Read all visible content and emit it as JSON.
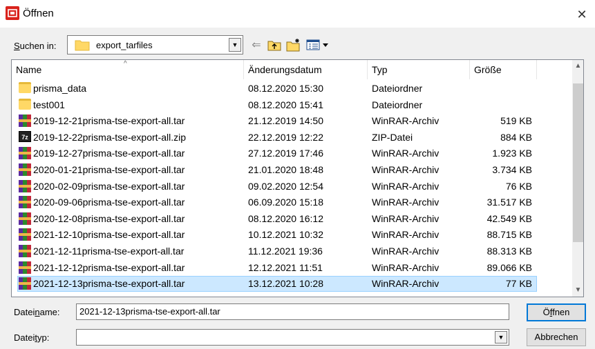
{
  "window": {
    "title": "Öffnen"
  },
  "toolbar": {
    "look_in_label_pre": "",
    "look_in_label_u": "S",
    "look_in_label_post": "uchen in:",
    "look_in_value": "export_tarfiles"
  },
  "columns": {
    "name": "Name",
    "date": "Änderungsdatum",
    "type": "Typ",
    "size": "Größe"
  },
  "files": [
    {
      "icon": "folder-icon",
      "name": "prisma_data",
      "date": "08.12.2020 15:30",
      "type": "Dateiordner",
      "size": ""
    },
    {
      "icon": "folder-icon",
      "name": "test001",
      "date": "08.12.2020 15:41",
      "type": "Dateiordner",
      "size": ""
    },
    {
      "icon": "winrar-icon",
      "name": "2019-12-21prisma-tse-export-all.tar",
      "date": "21.12.2019 14:50",
      "type": "WinRAR-Archiv",
      "size": "519 KB"
    },
    {
      "icon": "zip-icon",
      "name": "2019-12-22prisma-tse-export-all.zip",
      "date": "22.12.2019 12:22",
      "type": "ZIP-Datei",
      "size": "884 KB"
    },
    {
      "icon": "winrar-icon",
      "name": "2019-12-27prisma-tse-export-all.tar",
      "date": "27.12.2019 17:46",
      "type": "WinRAR-Archiv",
      "size": "1.923 KB"
    },
    {
      "icon": "winrar-icon",
      "name": "2020-01-21prisma-tse-export-all.tar",
      "date": "21.01.2020 18:48",
      "type": "WinRAR-Archiv",
      "size": "3.734 KB"
    },
    {
      "icon": "winrar-icon",
      "name": "2020-02-09prisma-tse-export-all.tar",
      "date": "09.02.2020 12:54",
      "type": "WinRAR-Archiv",
      "size": "76 KB"
    },
    {
      "icon": "winrar-icon",
      "name": "2020-09-06prisma-tse-export-all.tar",
      "date": "06.09.2020 15:18",
      "type": "WinRAR-Archiv",
      "size": "31.517 KB"
    },
    {
      "icon": "winrar-icon",
      "name": "2020-12-08prisma-tse-export-all.tar",
      "date": "08.12.2020 16:12",
      "type": "WinRAR-Archiv",
      "size": "42.549 KB"
    },
    {
      "icon": "winrar-icon",
      "name": "2021-12-10prisma-tse-export-all.tar",
      "date": "10.12.2021 10:32",
      "type": "WinRAR-Archiv",
      "size": "88.715 KB"
    },
    {
      "icon": "winrar-icon",
      "name": "2021-12-11prisma-tse-export-all.tar",
      "date": "11.12.2021 19:36",
      "type": "WinRAR-Archiv",
      "size": "88.313 KB"
    },
    {
      "icon": "winrar-icon",
      "name": "2021-12-12prisma-tse-export-all.tar",
      "date": "12.12.2021 11:51",
      "type": "WinRAR-Archiv",
      "size": "89.066 KB"
    },
    {
      "icon": "winrar-icon",
      "name": "2021-12-13prisma-tse-export-all.tar",
      "date": "13.12.2021 10:28",
      "type": "WinRAR-Archiv",
      "size": "77 KB",
      "selected": true
    }
  ],
  "filename": {
    "label_pre": "Datei",
    "label_u": "n",
    "label_post": "ame:",
    "value": "2021-12-13prisma-tse-export-all.tar"
  },
  "filetype": {
    "label_pre": "Datei",
    "label_u": "t",
    "label_post": "yp:",
    "value": ""
  },
  "buttons": {
    "open_pre": "Ö",
    "open_u": "f",
    "open_post": "fnen",
    "cancel": "Abbrechen"
  },
  "colors": {
    "accent": "#0078d7",
    "selection": "#cce8ff",
    "app_icon": "#d9231c"
  }
}
